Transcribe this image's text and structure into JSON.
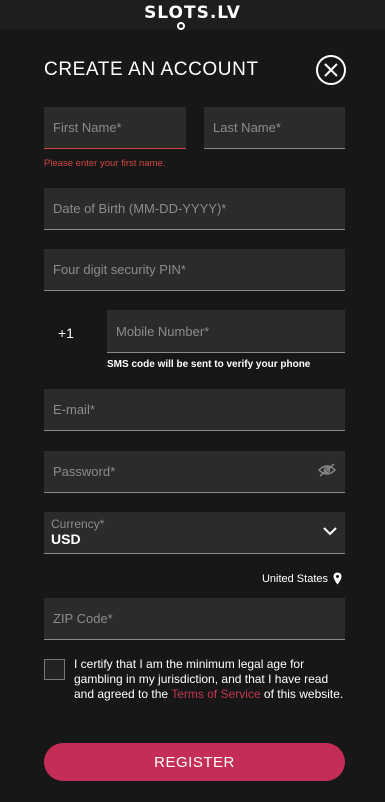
{
  "header": {
    "logo_text": "SLOTS.LV"
  },
  "form": {
    "title": "CREATE AN ACCOUNT",
    "first_name": {
      "placeholder": "First Name*",
      "error": "Please enter your first name."
    },
    "last_name": {
      "placeholder": "Last Name*"
    },
    "dob": {
      "placeholder": "Date of Birth (MM-DD-YYYY)*"
    },
    "pin": {
      "placeholder": "Four digit security PIN*"
    },
    "phone": {
      "country_code": "+1",
      "placeholder": "Mobile Number*",
      "note": "SMS code will be sent to verify your phone"
    },
    "email": {
      "placeholder": "E-mail*"
    },
    "password": {
      "placeholder": "Password*"
    },
    "currency": {
      "label": "Currency*",
      "value": "USD"
    },
    "location": "United States",
    "zip": {
      "placeholder": "ZIP Code*"
    },
    "certify": {
      "text_before": "I certify that I am the minimum legal age for gambling in my jurisdiction, and that I have read and agreed to the ",
      "link_text": "Terms of Service",
      "text_after": " of this website."
    },
    "register_label": "REGISTER"
  },
  "colors": {
    "accent": "#c42d55",
    "error": "#d0463f",
    "link": "#c0364f"
  }
}
